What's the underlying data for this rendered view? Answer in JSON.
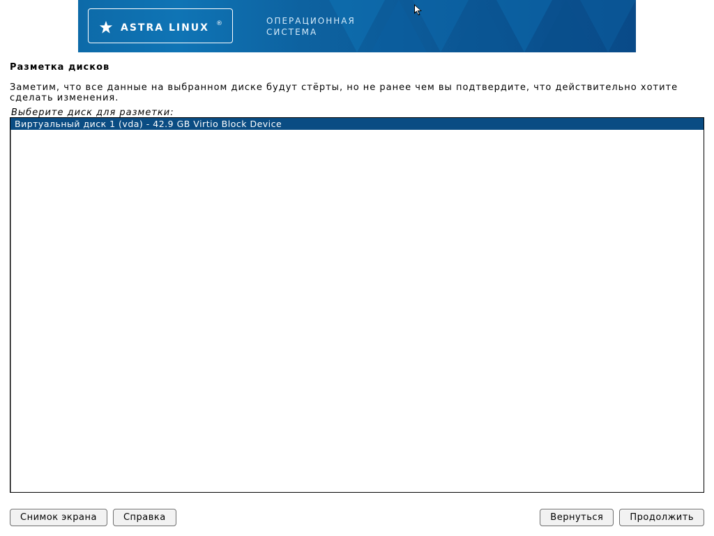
{
  "banner": {
    "brand": "ASTRA LINUX",
    "subtitle_line1": "ОПЕРАЦИОННАЯ",
    "subtitle_line2": "СИСТЕМА"
  },
  "page": {
    "title": "Разметка дисков",
    "description": "Заметим, что все данные на выбранном диске будут стёрты, но не ранее чем вы подтвердите, что действительно хотите сделать изменения.",
    "prompt": "Выберите диск для разметки:"
  },
  "disks": {
    "items": [
      {
        "label": "Виртуальный диск 1 (vda) - 42.9 GB Virtio Block Device",
        "selected": true
      }
    ]
  },
  "buttons": {
    "screenshot": "Снимок экрана",
    "help": "Справка",
    "back": "Вернуться",
    "continue": "Продолжить"
  },
  "colors": {
    "banner_dark": "#094a88",
    "banner_light": "#0f74b5",
    "selection": "#0a4c83"
  }
}
